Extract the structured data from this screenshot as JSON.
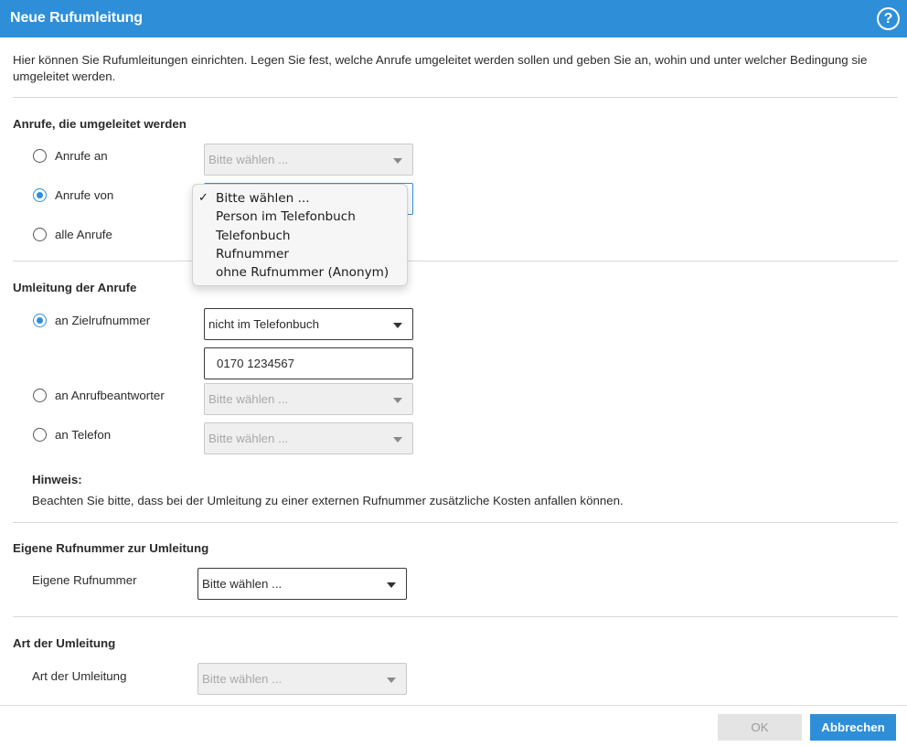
{
  "dialog": {
    "title": "Neue Rufumleitung",
    "help_icon": "question-circle-icon",
    "intro": "Hier können Sie Rufumleitungen einrichten. Legen Sie fest, welche Anrufe umgeleitet werden sollen und geben Sie an, wohin und unter welcher Bedingung sie umgeleitet werden."
  },
  "calls_section": {
    "title": "Anrufe, die umgeleitet werden",
    "option_to": {
      "label": "Anrufe an",
      "select_value": "Bitte wählen ...",
      "checked": false
    },
    "option_from": {
      "label": "Anrufe von",
      "checked": true
    },
    "option_all": {
      "label": "alle Anrufe",
      "checked": false
    },
    "dropdown_options": [
      {
        "label": "Bitte wählen ...",
        "selected": true
      },
      {
        "label": "Person im Telefonbuch",
        "selected": false
      },
      {
        "label": "Telefonbuch",
        "selected": false
      },
      {
        "label": "Rufnummer",
        "selected": false
      },
      {
        "label": "ohne Rufnummer (Anonym)",
        "selected": false
      }
    ],
    "check_mark": "✓"
  },
  "redirect_section": {
    "title": "Umleitung der Anrufe",
    "target_number": {
      "label": "an Zielrufnummer",
      "select_value": "nicht im Telefonbuch",
      "input_value": "0170 1234567",
      "checked": true
    },
    "answering_machine": {
      "label": "an Anrufbeantworter",
      "select_value": "Bitte wählen ...",
      "checked": false
    },
    "phone": {
      "label": "an Telefon",
      "select_value": "Bitte wählen ...",
      "checked": false
    },
    "note_title": "Hinweis:",
    "note_text": "Beachten Sie bitte, dass bei der Umleitung zu einer externen Rufnummer zusätzliche Kosten anfallen können."
  },
  "own_number_section": {
    "title": "Eigene Rufnummer zur Umleitung",
    "label": "Eigene Rufnummer",
    "select_value": "Bitte wählen ..."
  },
  "type_section": {
    "title": "Art der Umleitung",
    "label": "Art der Umleitung",
    "select_value": "Bitte wählen ..."
  },
  "footer": {
    "ok_label": "OK",
    "cancel_label": "Abbrechen"
  },
  "colors": {
    "accent": "#2e8fd8",
    "disabled_bg": "#efefef"
  }
}
